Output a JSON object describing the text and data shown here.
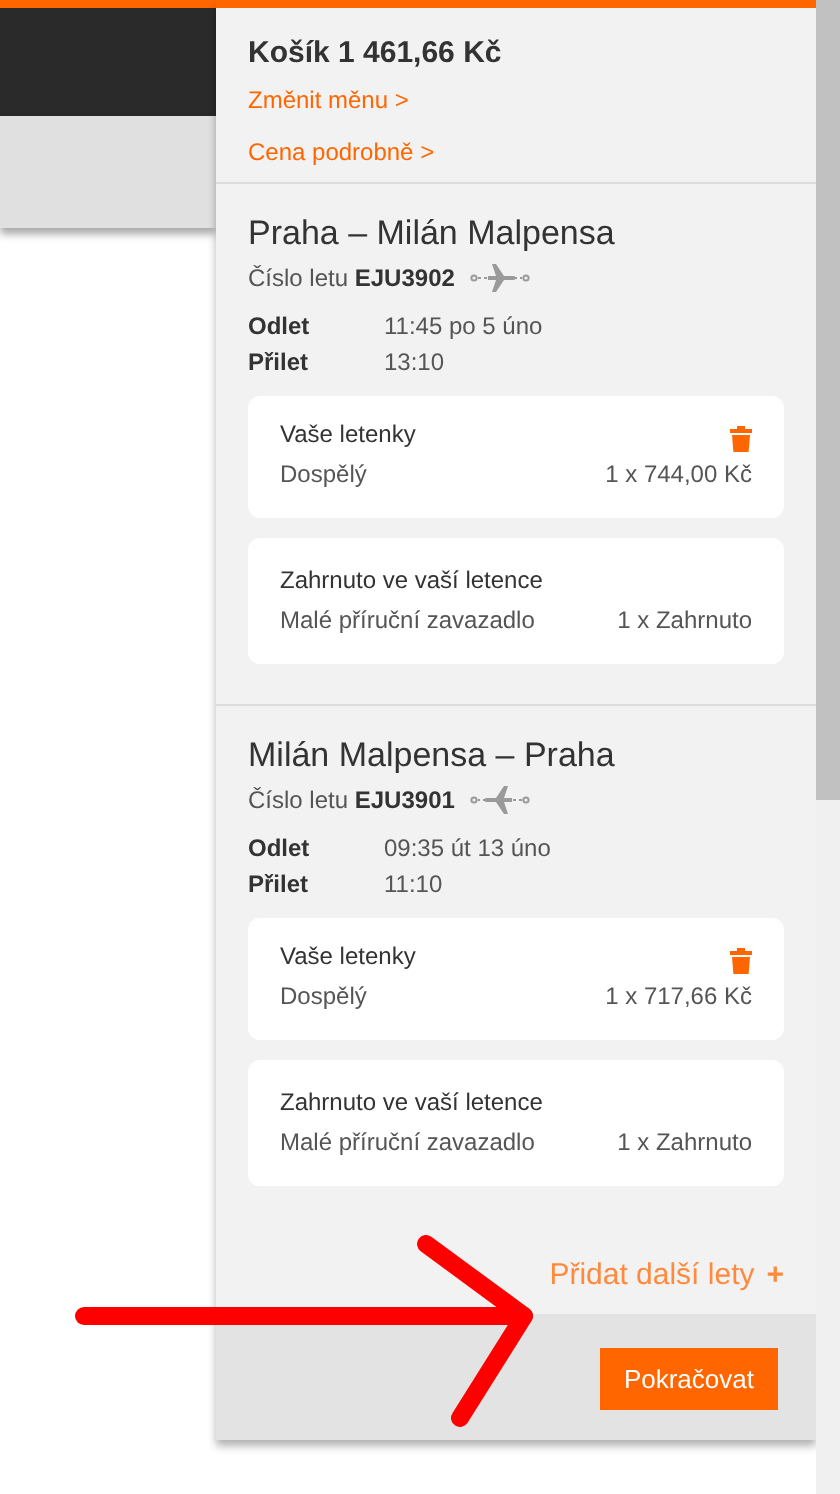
{
  "cart": {
    "title": "Košík 1 461,66 Kč",
    "links": [
      "Změnit měnu >",
      "Cena podrobně >"
    ]
  },
  "flights": [
    {
      "route": "Praha – Milán Malpensa",
      "flight_label": "Číslo letu",
      "flight_number": "EJU3902",
      "kind": "outbound",
      "times": [
        {
          "label": "Odlet",
          "value": "11:45 po 5 úno"
        },
        {
          "label": "Přilet",
          "value": "13:10"
        }
      ],
      "tickets": {
        "title": "Vaše letenky",
        "name": "Dospělý",
        "price": "1 x 744,00 Kč"
      },
      "included": {
        "title": "Zahrnuto ve vaší letence",
        "name": "Malé příruční zavazadlo",
        "value": "1 x Zahrnuto"
      }
    },
    {
      "route": "Milán Malpensa – Praha",
      "flight_label": "Číslo letu",
      "flight_number": "EJU3901",
      "kind": "return",
      "times": [
        {
          "label": "Odlet",
          "value": "09:35 út 13 úno"
        },
        {
          "label": "Přilet",
          "value": "11:10"
        }
      ],
      "tickets": {
        "title": "Vaše letenky",
        "name": "Dospělý",
        "price": "1 x 717,66 Kč"
      },
      "included": {
        "title": "Zahrnuto ve vaší letence",
        "name": "Malé příruční zavazadlo",
        "value": "1 x Zahrnuto"
      }
    }
  ],
  "add_flights": {
    "label": "Přidat další lety",
    "icon": "+"
  },
  "continue_button": "Pokračovat"
}
